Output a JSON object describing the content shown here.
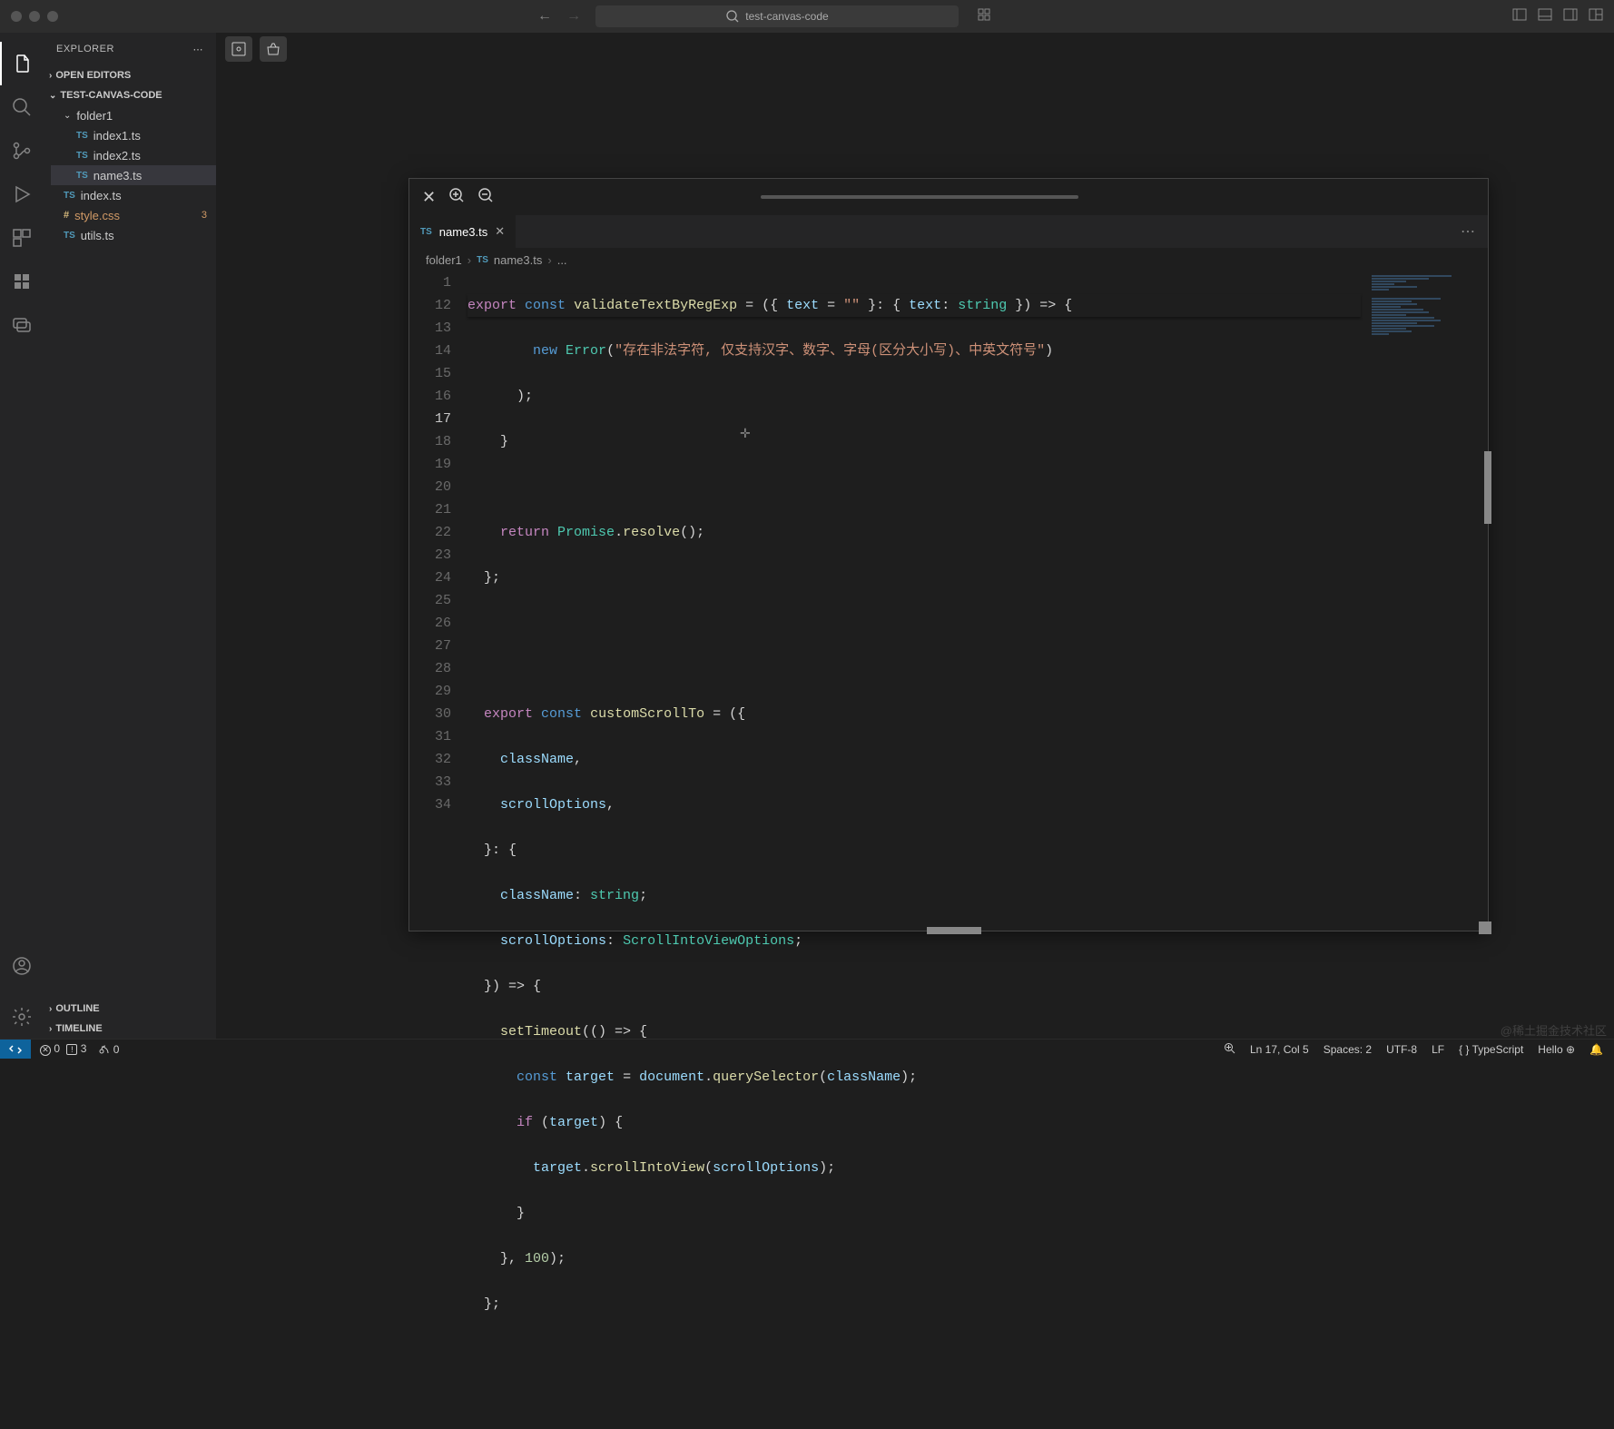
{
  "title_bar": {
    "search_text": "test-canvas-code"
  },
  "sidebar": {
    "title": "EXPLORER",
    "sections": {
      "open_editors": "OPEN EDITORS",
      "project": "TEST-CANVAS-CODE",
      "outline": "OUTLINE",
      "timeline": "TIMELINE"
    },
    "folder1": "folder1",
    "files": {
      "index1": "index1.ts",
      "index2": "index2.ts",
      "name3": "name3.ts",
      "index": "index.ts",
      "style": "style.css",
      "style_mod": "3",
      "utils": "utils.ts"
    }
  },
  "canvas": {
    "tab_label": "name3.ts",
    "breadcrumb": {
      "folder": "folder1",
      "file": "name3.ts",
      "tail": "..."
    },
    "code": {
      "line_numbers": [
        "1",
        "12",
        "13",
        "14",
        "15",
        "16",
        "17",
        "18",
        "19",
        "20",
        "21",
        "22",
        "23",
        "24",
        "25",
        "26",
        "27",
        "28",
        "29",
        "30",
        "31",
        "32",
        "33",
        "34"
      ],
      "sticky": {
        "export": "export",
        "const": "const",
        "fn": "validateTextByRegExp",
        "text": "text",
        "string": "string",
        "rest": " = ({ ",
        "eq": " = ",
        "empty": "\"\"",
        "tail": " }: { ",
        "arrow": " }) => {"
      },
      "l12": {
        "new": "new",
        "Error": "Error",
        "str": "\"存在非法字符, 仅支持汉字、数字、字母(区分大小写)、中英文符号\""
      },
      "l13": ");",
      "l14": "}",
      "l16": {
        "return": "return",
        "Promise": "Promise",
        "resolve": "resolve",
        "tail": "();"
      },
      "l17": "};",
      "l20": {
        "export": "export",
        "const": "const",
        "fn": "customScrollTo",
        "tail": " = ({"
      },
      "l21": {
        "v": "className",
        "c": ","
      },
      "l22": {
        "v": "scrollOptions",
        "c": ","
      },
      "l23": "}: {",
      "l24": {
        "v": "className",
        "t": "string",
        "c": ": ",
        "e": ";"
      },
      "l25": {
        "v": "scrollOptions",
        "t": "ScrollIntoViewOptions",
        "c": ": ",
        "e": ";"
      },
      "l26": "}) => {",
      "l27": {
        "fn": "setTimeout",
        "tail": "(() => {"
      },
      "l28": {
        "const": "const",
        "target": "target",
        "doc": "document",
        "qs": "querySelector",
        "cn": "className",
        "tail1": " = ",
        "tail2": ".",
        "tail3": "(",
        "tail4": ");"
      },
      "l29": {
        "if": "if",
        "target": "target",
        "p1": " (",
        "p2": ") {"
      },
      "l30": {
        "target": "target",
        "fn": "scrollIntoView",
        "so": "scrollOptions",
        "d": ".",
        "p1": "(",
        "p2": ");"
      },
      "l31": "}",
      "l32": {
        "p1": "}, ",
        "num": "100",
        "p2": ");"
      },
      "l33": "};"
    }
  },
  "status": {
    "errors": "0",
    "warnings": "3",
    "ports": "0",
    "position": "Ln 17, Col 5",
    "spaces": "Spaces: 2",
    "encoding": "UTF-8",
    "eol": "LF",
    "lang": "TypeScript",
    "hello": "Hello"
  },
  "watermark": "@稀土掘金技术社区"
}
